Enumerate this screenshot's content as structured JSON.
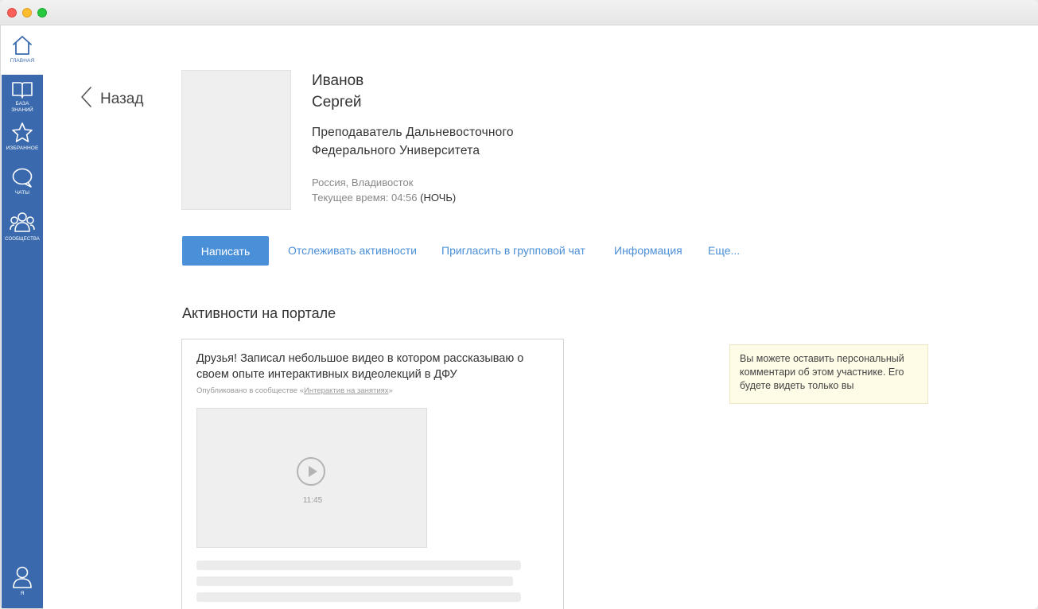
{
  "sidebar": {
    "items": [
      {
        "label": "Главная",
        "icon": "home-icon"
      },
      {
        "label": "База знаний",
        "icon": "book-icon"
      },
      {
        "label": "Избранное",
        "icon": "star-icon"
      },
      {
        "label": "Чаты",
        "icon": "chat-icon"
      },
      {
        "label": "Сообщества",
        "icon": "people-icon"
      },
      {
        "label": "Я",
        "icon": "user-icon"
      }
    ]
  },
  "nav": {
    "back_label": "Назад"
  },
  "profile": {
    "last_name": "Иванов",
    "first_name": "Сергей",
    "position_line1": "Преподаватель Дальневосточного",
    "position_line2": "Федерального Университета",
    "location": "Россия, Владивосток",
    "time_prefix": "Текущее время: 04:56",
    "time_period": "(НОЧЬ)"
  },
  "actions": {
    "write": "Написать",
    "track": "Отслеживать активности",
    "invite": "Пригласить в групповой чат",
    "info": "Информация",
    "more": "Еще..."
  },
  "activities": {
    "title": "Активности на портале",
    "post": {
      "text": "Друзья! Записал небольшое видео в котором рассказываю о своем опыте интерактивных видеолекций в ДФУ",
      "meta_prefix": "Опубликовано в сообществе «",
      "community": "Интерактив на занятиях",
      "meta_suffix": "»",
      "video_duration": "11:45"
    }
  },
  "note": {
    "text": "Вы можете оставить персональный комментари об этом участнике. Его будете видеть только вы"
  },
  "colors": {
    "sidebar": "#3a6aad",
    "accent": "#4a90d9",
    "link": "#4a8fd6",
    "note_bg": "#fefbe6"
  }
}
